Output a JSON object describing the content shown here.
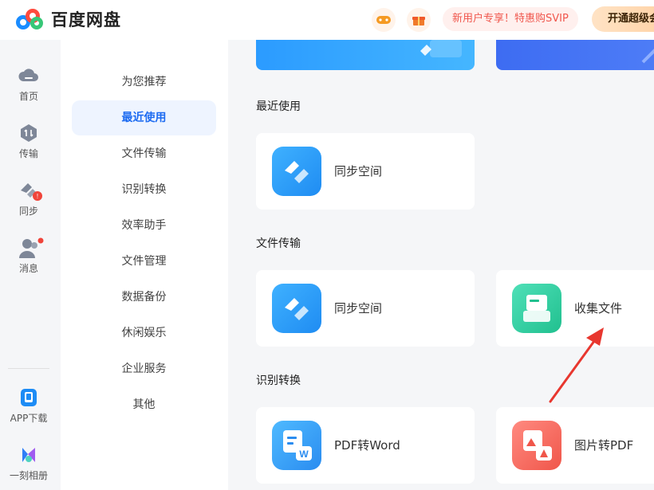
{
  "header": {
    "app_name": "百度网盘",
    "promo_text": "新用户专享！特惠购SVIP",
    "vip_button": "开通超级会员"
  },
  "leftnav": {
    "items": [
      {
        "label": "首页",
        "icon": "cloud-home-icon"
      },
      {
        "label": "传输",
        "icon": "transfer-icon"
      },
      {
        "label": "同步",
        "icon": "sync-icon"
      },
      {
        "label": "消息",
        "icon": "message-icon"
      }
    ],
    "bottom": [
      {
        "label": "APP下载",
        "icon": "phone-icon"
      },
      {
        "label": "一刻相册",
        "icon": "album-icon"
      }
    ]
  },
  "categories": {
    "items": [
      "为您推荐",
      "最近使用",
      "文件传输",
      "识别转换",
      "效率助手",
      "文件管理",
      "数据备份",
      "休闲娱乐",
      "企业服务",
      "其他"
    ],
    "active": "最近使用"
  },
  "sections": [
    {
      "title": "最近使用",
      "cards": [
        {
          "label": "同步空间",
          "icon": "sync-space-icon"
        }
      ]
    },
    {
      "title": "文件传输",
      "cards": [
        {
          "label": "同步空间",
          "icon": "sync-space-icon"
        },
        {
          "label": "收集文件",
          "icon": "collect-files-icon"
        }
      ]
    },
    {
      "title": "识别转换",
      "cards": [
        {
          "label": "PDF转Word",
          "icon": "pdf-to-word-icon"
        },
        {
          "label": "图片转PDF",
          "icon": "image-to-pdf-icon"
        }
      ]
    }
  ],
  "colors": {
    "accent": "#1d6bf1",
    "arrow": "#e8372f"
  }
}
